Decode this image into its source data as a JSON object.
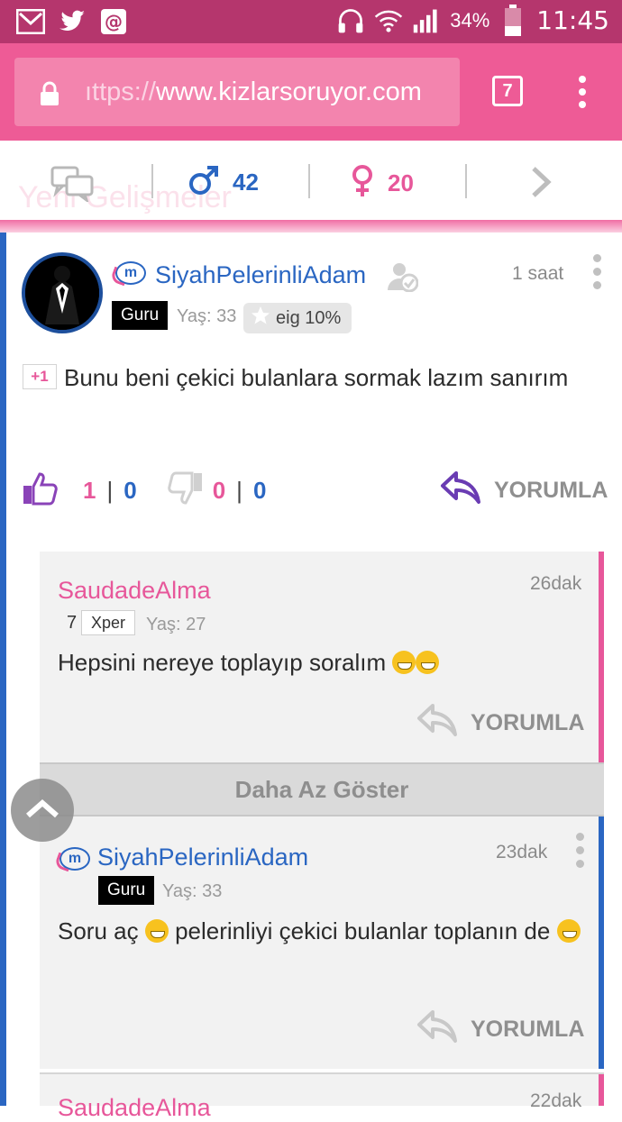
{
  "status_bar": {
    "battery": "34%",
    "time": "11:45"
  },
  "browser": {
    "url_prefix": "ıttps://",
    "url_domain": "www.kizlarsoruyor.com",
    "tab_count": "7"
  },
  "stats": {
    "faded_title": "Yeni Gelişmeler",
    "male_count": "42",
    "female_count": "20",
    "male_color": "#2a66c2",
    "female_color": "#e7579a"
  },
  "post": {
    "username": "SiyahPelerinliAdam",
    "badge": "Guru",
    "age": "Yaş: 33",
    "eig": "eig 10%",
    "time": "1 saat",
    "plus_one": "+1",
    "text": "Bunu beni çekici bulanlara sormak lazım sanırım",
    "likes": "1",
    "likes_secondary": "0",
    "dislikes": "0",
    "dislikes_secondary": "0",
    "reply_label": "YORUMLA"
  },
  "replies": [
    {
      "username": "SaudadeAlma",
      "time": "26dak",
      "level": "7",
      "badge": "Xper",
      "age": "Yaş: 27",
      "text": "Hepsini nereye toplayıp soralım",
      "reply_label": "YORUMLA",
      "accent": "#e7579a"
    },
    {
      "username": "SiyahPelerinliAdam",
      "time": "23dak",
      "badge": "Guru",
      "age": "Yaş: 33",
      "text_part1": "Soru aç",
      "text_part2": "pelerinliyi çekici bulanlar toplanın",
      "text_part3": "de",
      "reply_label": "YORUMLA",
      "accent": "#2a66c2"
    },
    {
      "username": "SaudadeAlma",
      "time": "22dak"
    }
  ],
  "show_less": "Daha Az Göster"
}
